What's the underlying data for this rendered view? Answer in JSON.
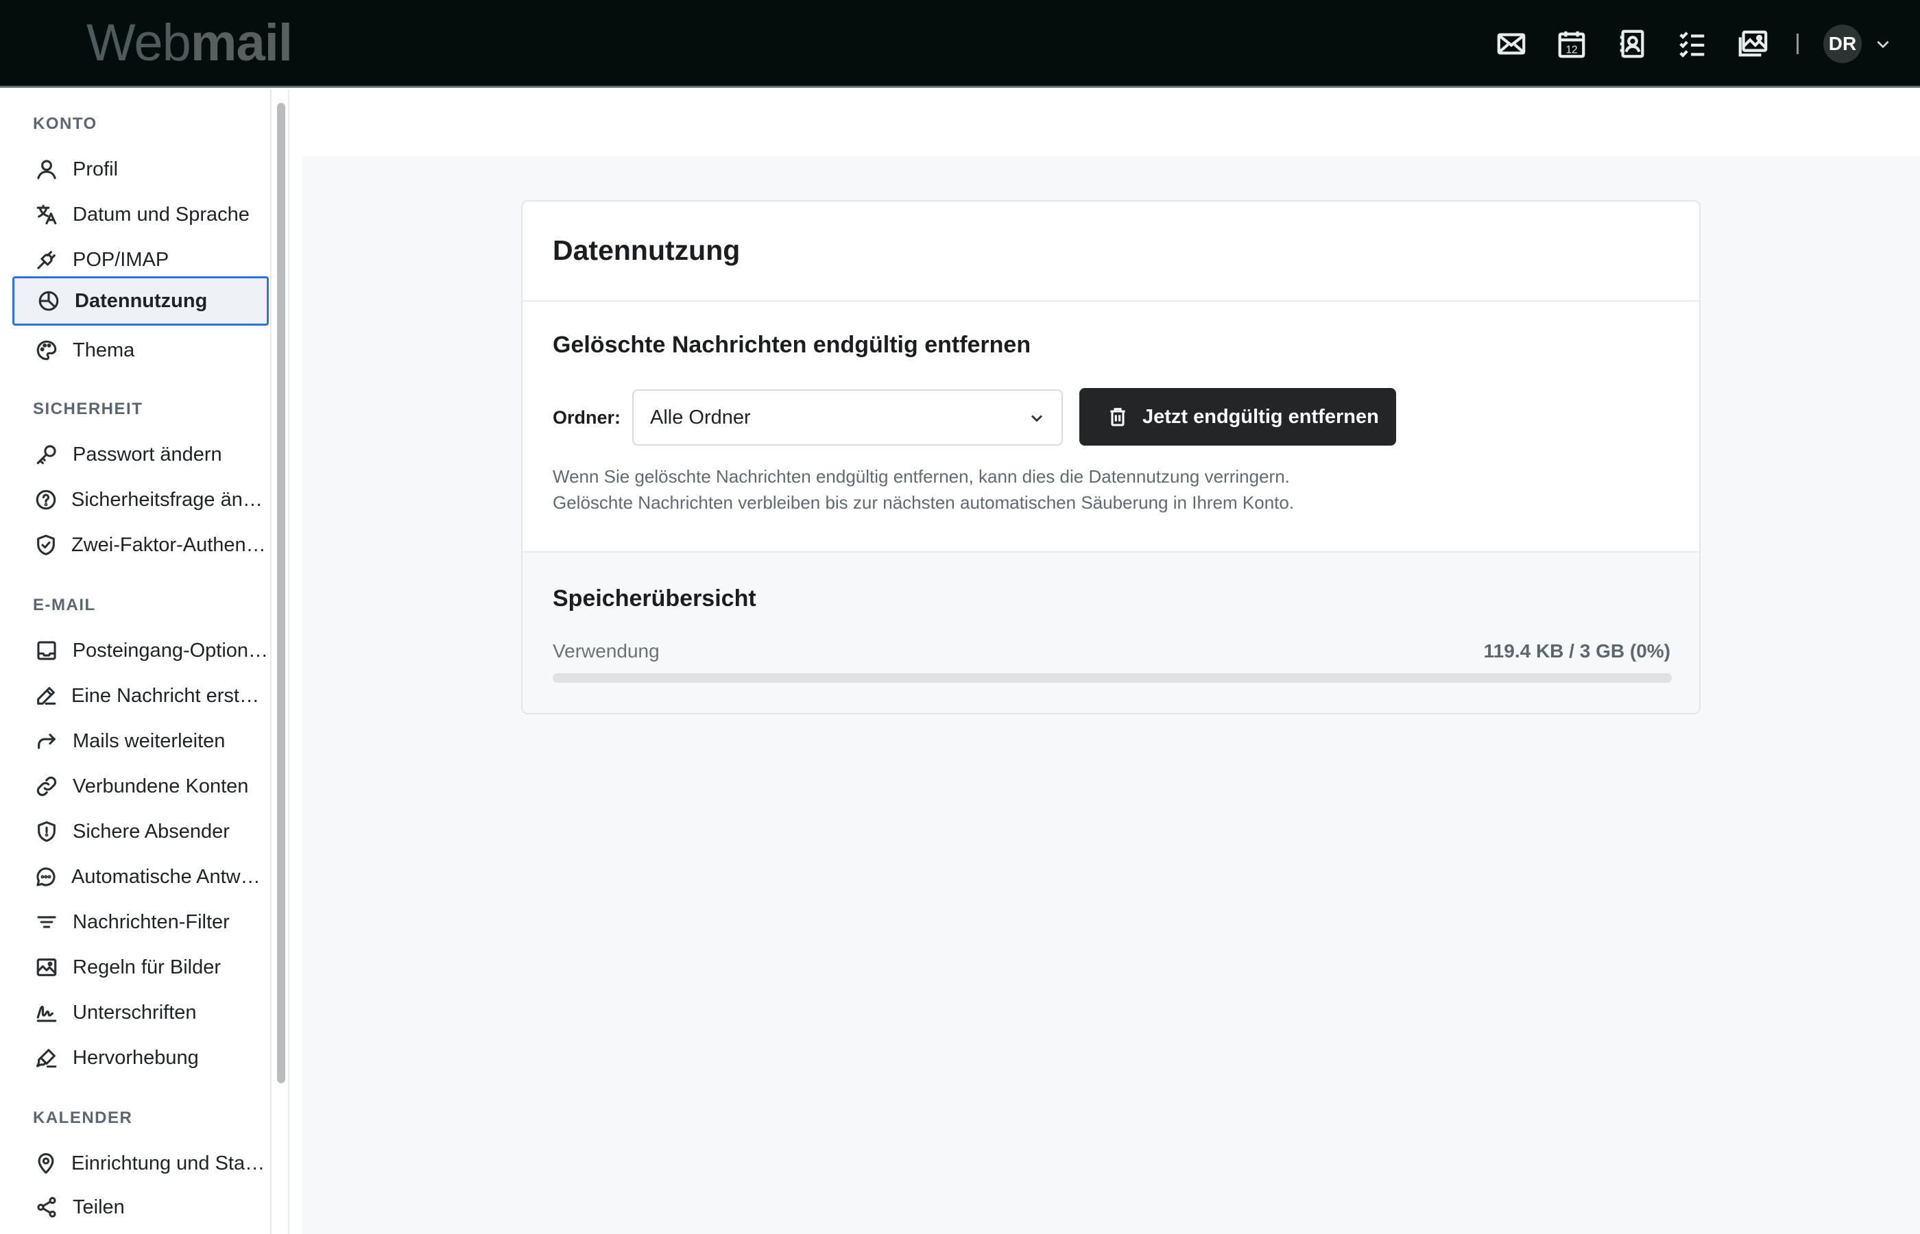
{
  "app": {
    "logo_light": "Web",
    "logo_bold": "mail"
  },
  "topbar": {
    "icons": [
      "mail-icon",
      "calendar-icon",
      "contacts-icon",
      "tasks-icon",
      "photos-icon"
    ],
    "calendar_day": "12",
    "avatar_initials": "DR"
  },
  "sidebar": {
    "sections": [
      {
        "title": "KONTO",
        "items": [
          {
            "label": "Profil",
            "icon": "user-icon"
          },
          {
            "label": "Datum und Sprache",
            "icon": "translate-icon"
          },
          {
            "label": "POP/IMAP",
            "icon": "plug-icon"
          },
          {
            "label": "Datennutzung",
            "icon": "pie-chart-icon",
            "active": true
          },
          {
            "label": "Thema",
            "icon": "palette-icon"
          }
        ]
      },
      {
        "title": "SICHERHEIT",
        "items": [
          {
            "label": "Passwort ändern",
            "icon": "key-icon"
          },
          {
            "label": "Sicherheitsfrage ändern",
            "icon": "question-circle-icon"
          },
          {
            "label": "Zwei-Faktor-Authentifizierung",
            "icon": "shield-check-icon"
          }
        ]
      },
      {
        "title": "E-MAIL",
        "items": [
          {
            "label": "Posteingang-Optionen",
            "icon": "inbox-icon"
          },
          {
            "label": "Eine Nachricht erstellen",
            "icon": "pencil-icon"
          },
          {
            "label": "Mails weiterleiten",
            "icon": "forward-arrow-icon"
          },
          {
            "label": "Verbundene Konten",
            "icon": "link-icon"
          },
          {
            "label": "Sichere Absender",
            "icon": "shield-alert-icon"
          },
          {
            "label": "Automatische Antworten",
            "icon": "chat-bubble-icon"
          },
          {
            "label": "Nachrichten-Filter",
            "icon": "filter-icon"
          },
          {
            "label": "Regeln für Bilder",
            "icon": "image-icon"
          },
          {
            "label": "Unterschriften",
            "icon": "signature-icon"
          },
          {
            "label": "Hervorhebung",
            "icon": "highlighter-icon"
          }
        ]
      },
      {
        "title": "KALENDER",
        "items": [
          {
            "label": "Einrichtung und Standort",
            "icon": "map-pin-icon"
          },
          {
            "label": "Teilen",
            "icon": "share-icon"
          }
        ]
      }
    ]
  },
  "main": {
    "card_title": "Datennutzung",
    "purge": {
      "title": "Gelöschte Nachrichten endgültig entfernen",
      "folder_label": "Ordner:",
      "folder_value": "Alle Ordner",
      "button_label": "Jetzt endgültig entfernen",
      "help_line1": "Wenn Sie gelöschte Nachrichten endgültig entfernen, kann dies die Datennutzung verringern.",
      "help_line2": "Gelöschte Nachrichten verbleiben bis zur nächsten automatischen Säuberung in Ihrem Konto."
    },
    "storage": {
      "title": "Speicherübersicht",
      "usage_label": "Verwendung",
      "usage_value": "119.4 KB / 3 GB (0%)",
      "usage_percent": 0
    }
  },
  "colors": {
    "topbar_bg": "#030d0b",
    "accent": "#2f6fde",
    "danger_button": "#232527",
    "main_bg": "#f7f8fa"
  }
}
